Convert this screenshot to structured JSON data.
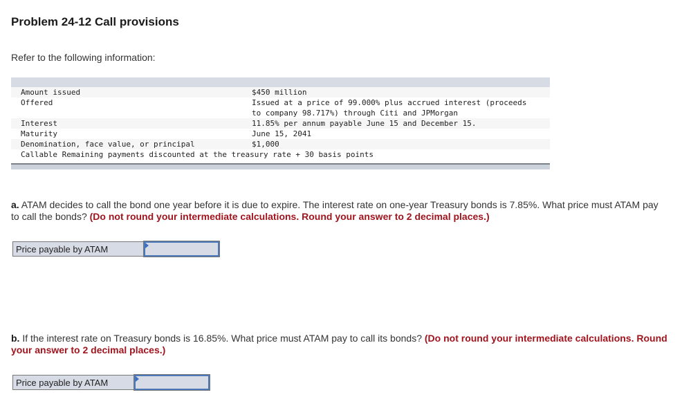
{
  "header": {
    "title": "Problem 24-12 Call provisions",
    "intro": "Refer to the following information:"
  },
  "info_table": {
    "rows": [
      {
        "label": "Amount issued",
        "value": "$450 million"
      },
      {
        "label": "Offered",
        "value": "Issued at a price of 99.000% plus accrued interest (proceeds"
      },
      {
        "label": "",
        "value": "to company 98.717%) through Citi and JPMorgan"
      },
      {
        "label": "Interest",
        "value": "11.85% per annum payable June 15 and December 15."
      },
      {
        "label": "Maturity",
        "value": "June 15, 2041"
      },
      {
        "label": "Denomination, face value, or principal",
        "value": "$1,000"
      }
    ],
    "callable_row": "Callable Remaining payments discounted at the treasury rate + 30 basis points"
  },
  "questions": [
    {
      "part": "a.",
      "text": " ATAM decides to call the bond one year before it is due to expire. The interest rate on one-year Treasury bonds is 7.85%. What price must ATAM pay to call the bonds? ",
      "note": "(Do not round your intermediate calculations. Round your answer to 2 decimal places.)",
      "answer_label": "Price payable by ATAM",
      "answer_value": ""
    },
    {
      "part": "b.",
      "text": " If the interest rate on Treasury bonds is 16.85%. What price must ATAM pay to call its bonds? ",
      "note": "(Do not round your intermediate calculations. Round your answer to 2 decimal places.)",
      "answer_label": "Price payable by ATAM",
      "answer_value": ""
    }
  ],
  "colors": {
    "note_red": "#a0141e",
    "input_border": "#4a78b8",
    "input_bg": "#d7dbe6"
  }
}
